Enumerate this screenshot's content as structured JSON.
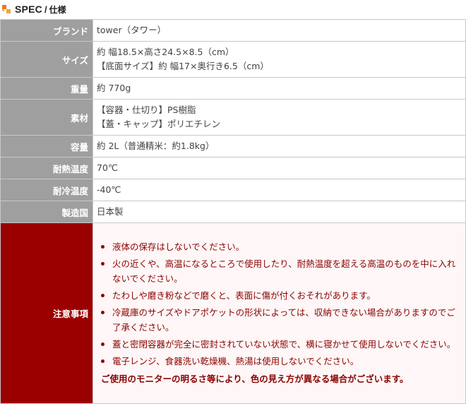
{
  "header": {
    "title": "SPEC",
    "separator": "/",
    "subtitle": "仕様",
    "icon": "orange-squares-icon"
  },
  "spec": {
    "brand": {
      "label": "ブランド",
      "value": "tower（タワー）"
    },
    "size": {
      "label": "サイズ",
      "lines": [
        "約 幅18.5×高さ24.5×8.5（cm）",
        "【底面サイズ】約 幅17×奥行き6.5（cm）"
      ]
    },
    "weight": {
      "label": "重量",
      "value": "約 770g"
    },
    "material": {
      "label": "素材",
      "lines": [
        "【容器・仕切り】PS樹脂",
        "【蓋・キャップ】ポリエチレン"
      ]
    },
    "capacity": {
      "label": "容量",
      "value": "約 2L（普通精米：約1.8kg）"
    },
    "heat": {
      "label": "耐熱温度",
      "value": "70℃"
    },
    "cold": {
      "label": "耐冷温度",
      "value": "-40℃"
    },
    "origin": {
      "label": "製造国",
      "value": "日本製"
    },
    "caution": {
      "label": "注意事項",
      "items": [
        "液体の保存はしないでください。",
        "火の近くや、高温になるところで使用したり、耐熱温度を超える高温のものを中に入れないでください。",
        "たわしや磨き粉などで磨くと、表面に傷が付くおそれがあります。",
        "冷蔵庫のサイズやドアポケットの形状によっては、収納できない場合がありますのでご了承ください。",
        "蓋と密閉容器が完全に密封されていない状態で、横に寝かせて使用しないでください。",
        "電子レンジ、食器洗い乾燥機、熱湯は使用しないでください。"
      ],
      "notice": "ご使用のモニターの明るさ等により、色の見え方が異なる場合がございます。"
    }
  },
  "colors": {
    "label_bg": "#9f9f9f",
    "caution_bg": "#9b0000",
    "caution_text": "#8b0000",
    "accent_icon": "#e87a1e"
  }
}
